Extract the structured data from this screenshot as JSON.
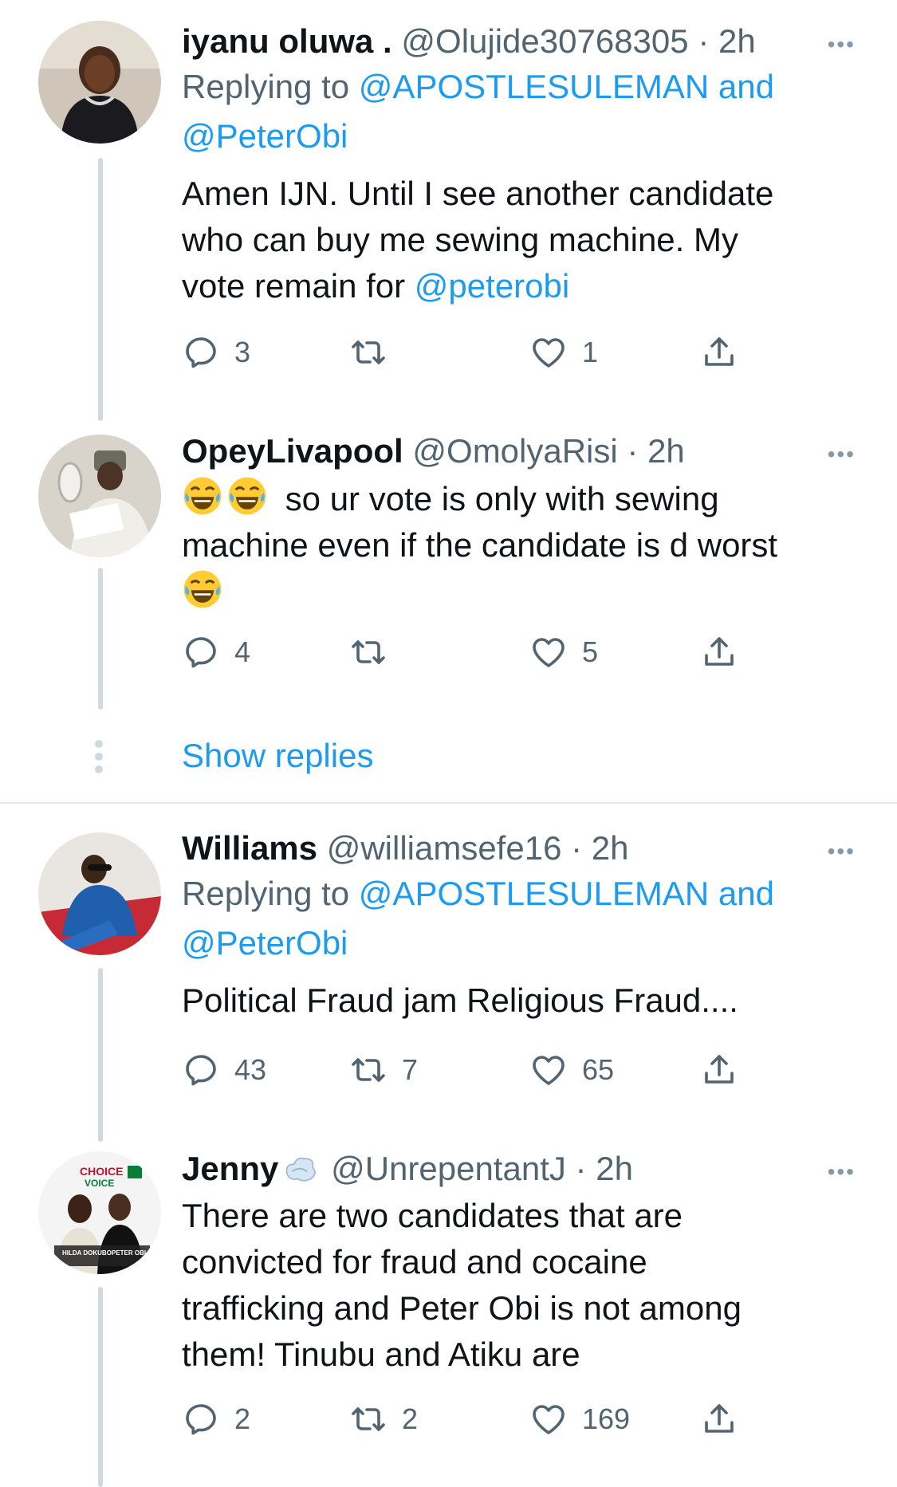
{
  "tweets": [
    {
      "name": "iyanu oluwa .",
      "handle": "@Olujide30768305",
      "time": "2h",
      "reply_prefix": "Replying to",
      "reply_mention1": "@APOSTLESULEMAN and",
      "reply_mention2": "@PeterObi",
      "text_line1": "Amen IJN.  Until I see another candidate",
      "text_line2": "who can buy me sewing machine. My",
      "text_line3_prefix": "vote remain for",
      "text_line3_mention": "@peterobi",
      "reply_count": "3",
      "retweet_count": "",
      "like_count": "1"
    },
    {
      "name": "OpeyLivapool",
      "handle": "@OmolyaRisi",
      "time": "2h",
      "text_line1": "so ur vote is only with sewing",
      "text_line2": "machine even if the candidate is d worst",
      "emoji_name": "face-with-tears-of-joy",
      "reply_count": "4",
      "retweet_count": "",
      "like_count": "5"
    },
    {
      "name": "Williams",
      "handle": "@williamsefe16",
      "time": "2h",
      "reply_prefix": "Replying to",
      "reply_mention1": "@APOSTLESULEMAN and",
      "reply_mention2": "@PeterObi",
      "text_line1": "Political Fraud jam Religious Fraud....",
      "reply_count": "43",
      "retweet_count": "7",
      "like_count": "65"
    },
    {
      "name": "Jenny",
      "handle": "@UnrepentantJ",
      "time": "2h",
      "text_line1": "There are two candidates that are",
      "text_line2": "convicted for fraud and cocaine",
      "text_line3": "trafficking and Peter Obi is not among",
      "text_line4": "them! Tinubu and Atiku are",
      "reply_count": "2",
      "retweet_count": "2",
      "like_count": "169",
      "avatar_text": {
        "top": "CHOICE",
        "mid": "VOICE",
        "left_name": "HILDA DOKUBO",
        "right_name": "PETER OBI"
      }
    }
  ],
  "show_replies": "Show replies",
  "dot": "·",
  "more": "•••",
  "colors": {
    "accent": "#1d9bf0",
    "muted": "#536471",
    "line": "#cfd9de"
  }
}
